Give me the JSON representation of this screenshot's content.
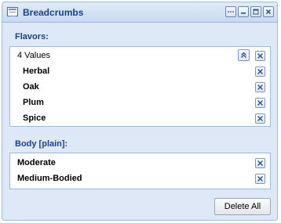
{
  "panel": {
    "title": "Breadcrumbs",
    "tools": [
      "menu-icon",
      "minimize-icon",
      "maximize-icon",
      "close-icon"
    ]
  },
  "flavors": {
    "label": "Flavors:",
    "summary": "4 Values",
    "items": [
      "Herbal",
      "Oak",
      "Plum",
      "Spice"
    ]
  },
  "body": {
    "label": "Body [plain]:",
    "items": [
      "Moderate",
      "Medium-Bodied"
    ]
  },
  "footer": {
    "delete_all_label": "Delete All"
  },
  "colors": {
    "panel_background": "#dfe8f6",
    "header_text": "#15428b",
    "border": "#99bbe8"
  }
}
